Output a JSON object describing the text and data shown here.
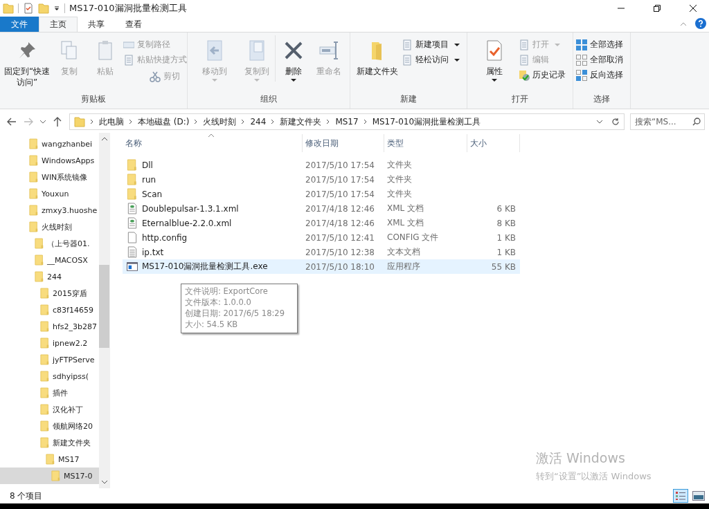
{
  "window": {
    "title": "MS17-010漏洞批量检测工具"
  },
  "ribbon_tabs": [
    {
      "label": "文件",
      "kind": "file",
      "selected": false
    },
    {
      "label": "主页",
      "kind": "tab",
      "selected": true
    },
    {
      "label": "共享",
      "kind": "tab",
      "selected": false
    },
    {
      "label": "查看",
      "kind": "tab",
      "selected": false
    }
  ],
  "ribbon_groups": [
    {
      "label": "剪贴板",
      "buttons": [
        {
          "kind": "large",
          "label": "固定到“快速访问”",
          "disabled": false,
          "dropdown": false
        },
        {
          "kind": "large",
          "label": "复制",
          "disabled": true,
          "dropdown": false
        },
        {
          "kind": "large",
          "label": "粘贴",
          "disabled": true,
          "dropdown": false
        },
        {
          "kind": "stack",
          "items": [
            {
              "label": "复制路径",
              "disabled": true,
              "dropdown": false
            },
            {
              "label": "粘贴快捷方式",
              "disabled": true,
              "dropdown": false
            }
          ]
        },
        {
          "kind": "small",
          "label": "剪切",
          "disabled": true
        }
      ]
    },
    {
      "label": "组织",
      "buttons": [
        {
          "kind": "large",
          "label": "移动到",
          "disabled": true,
          "dropdown": true
        },
        {
          "kind": "large",
          "label": "复制到",
          "disabled": true,
          "dropdown": true
        },
        {
          "kind": "large",
          "label": "删除",
          "disabled": false,
          "dropdown": true
        },
        {
          "kind": "large",
          "label": "重命名",
          "disabled": true,
          "dropdown": false
        }
      ]
    },
    {
      "label": "新建",
      "buttons": [
        {
          "kind": "large",
          "label": "新建文件夹",
          "disabled": false,
          "dropdown": false
        },
        {
          "kind": "stack",
          "items": [
            {
              "label": "新建项目",
              "disabled": false,
              "dropdown": true
            },
            {
              "label": "轻松访问",
              "disabled": false,
              "dropdown": true
            }
          ]
        }
      ]
    },
    {
      "label": "打开",
      "buttons": [
        {
          "kind": "large",
          "label": "属性",
          "disabled": false,
          "dropdown": true
        },
        {
          "kind": "stack",
          "items": [
            {
              "label": "打开",
              "disabled": true,
              "dropdown": true
            },
            {
              "label": "编辑",
              "disabled": true,
              "dropdown": false
            },
            {
              "label": "历史记录",
              "disabled": false,
              "dropdown": false
            }
          ]
        }
      ]
    },
    {
      "label": "选择",
      "buttons": [
        {
          "kind": "stack",
          "items": [
            {
              "label": "全部选择",
              "disabled": false,
              "dropdown": false
            },
            {
              "label": "全部取消",
              "disabled": false,
              "dropdown": false
            },
            {
              "label": "反向选择",
              "disabled": false,
              "dropdown": false
            }
          ]
        }
      ]
    }
  ],
  "breadcrumbs": [
    "此电脑",
    "本地磁盘 (D:)",
    "火线时刻",
    "244",
    "新建文件夹",
    "MS17",
    "MS17-010漏洞批量检测工具"
  ],
  "search": {
    "placeholder": "搜索“MS..."
  },
  "sidebar": {
    "items": [
      {
        "label": "wangzhanbei",
        "selected": false
      },
      {
        "label": "WindowsApps",
        "selected": false
      },
      {
        "label": "WIN系统镜像",
        "selected": false
      },
      {
        "label": "Youxun",
        "selected": false
      },
      {
        "label": "zmxy3.huoshe",
        "selected": false
      },
      {
        "label": "火线时刻",
        "selected": false,
        "children": [
          {
            "label": "（上号器01.",
            "selected": false
          },
          {
            "label": "__MACOSX",
            "selected": false
          },
          {
            "label": "244",
            "selected": false,
            "children": [
              {
                "label": "2015穿盾",
                "selected": false
              },
              {
                "label": "c83f14659",
                "selected": false
              },
              {
                "label": "hfs2_3b287",
                "selected": false
              },
              {
                "label": "ipnew2.2",
                "selected": false
              },
              {
                "label": "jyFTPServe",
                "selected": false
              },
              {
                "label": "sdhyipss(",
                "selected": false
              },
              {
                "label": "插件",
                "selected": false
              },
              {
                "label": "汉化补丁",
                "selected": false
              },
              {
                "label": "领航网络20",
                "selected": false
              },
              {
                "label": "新建文件夹",
                "selected": false,
                "children": [
                  {
                    "label": "MS17",
                    "selected": false,
                    "children": [
                      {
                        "label": "MS17-0",
                        "selected": true
                      }
                    ]
                  }
                ]
              }
            ]
          }
        ]
      }
    ]
  },
  "table": {
    "columns": [
      "名称",
      "修改日期",
      "类型",
      "大小"
    ],
    "rows": [
      {
        "kind": "folder",
        "name": "Dll",
        "date": "2017/5/10 17:54",
        "type": "文件夹",
        "selected": false
      },
      {
        "kind": "folder",
        "name": "run",
        "date": "2017/5/10 17:54",
        "type": "文件夹",
        "selected": false
      },
      {
        "kind": "folder",
        "name": "Scan",
        "date": "2017/5/10 17:54",
        "type": "文件夹",
        "selected": false
      },
      {
        "kind": "xml",
        "name": "Doublepulsar-1.3.1.xml",
        "date": "2017/4/18 12:46",
        "type": "XML 文档",
        "size": "6 KB",
        "selected": false
      },
      {
        "kind": "xml",
        "name": "Eternalblue-2.2.0.xml",
        "date": "2017/4/18 12:46",
        "type": "XML 文档",
        "size": "8 KB",
        "selected": false
      },
      {
        "kind": "file",
        "name": "http.config",
        "date": "2017/5/10 12:41",
        "type": "CONFIG 文件",
        "size": "1 KB",
        "selected": false
      },
      {
        "kind": "text",
        "name": "ip.txt",
        "date": "2017/5/10 12:38",
        "type": "文本文档",
        "size": "1 KB",
        "selected": false
      },
      {
        "kind": "exe",
        "name": "MS17-010漏洞批量检测工具.exe",
        "date": "2017/5/10 18:10",
        "type": "应用程序",
        "size": "55 KB",
        "selected": true
      }
    ]
  },
  "tooltip": [
    "文件说明: ExportCore",
    "文件版本: 1.0.0.0",
    "创建日期: 2017/6/5 18:29",
    "大小: 54.5 KB"
  ],
  "activation": {
    "title": "激活 Windows",
    "subtitle": "转到“设置”以激活 Windows"
  },
  "status_bar": {
    "count": "8 个项目"
  },
  "view_modes": [
    {
      "kind": "details",
      "selected": true
    },
    {
      "kind": "thumbnails",
      "selected": false
    }
  ]
}
